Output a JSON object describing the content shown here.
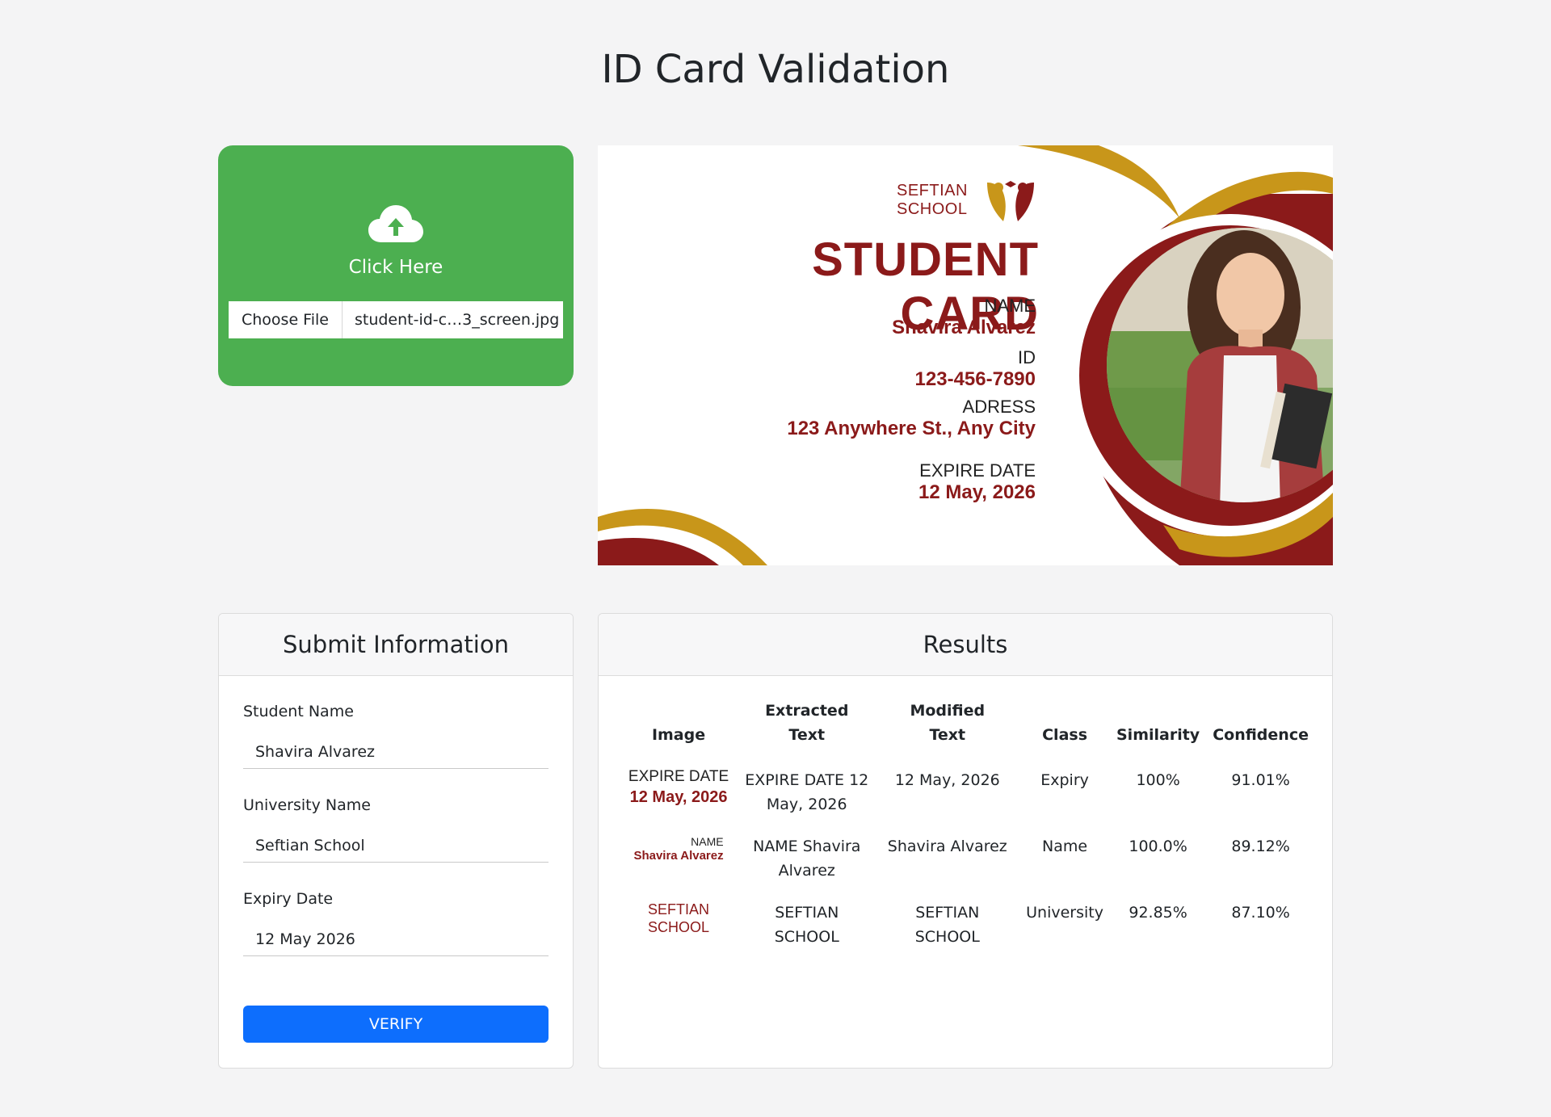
{
  "page": {
    "title": "ID Card Validation"
  },
  "upload": {
    "label": "Click Here",
    "choose_file": "Choose File",
    "file_name": "student-id-c…3_screen.jpg",
    "icon": "cloud-upload-icon"
  },
  "card": {
    "school_line1": "SEFTIAN",
    "school_line2": "SCHOOL",
    "title": "STUDENT CARD",
    "name_label": "NAME",
    "name_value": "Shavira Alvarez",
    "id_label": "ID",
    "id_value": "123-456-7890",
    "address_label": "ADRESS",
    "address_value": "123 Anywhere St., Any City",
    "expire_label": "EXPIRE DATE",
    "expire_value": "12 May, 2026",
    "colors": {
      "maroon": "#8b1a1a",
      "gold": "#c8961a"
    }
  },
  "submit": {
    "header": "Submit Information",
    "student_name_label": "Student Name",
    "student_name_value": "Shavira Alvarez",
    "university_label": "University Name",
    "university_value": "Seftian School",
    "expiry_label": "Expiry Date",
    "expiry_value": "12 May 2026",
    "verify_label": "VERIFY",
    "button_color": "#0d6efd"
  },
  "results": {
    "header": "Results",
    "columns": {
      "image": "Image",
      "extracted": "Extracted Text",
      "modified": "Modified Text",
      "class": "Class",
      "similarity": "Similarity",
      "confidence": "Confidence"
    },
    "rows": [
      {
        "image_label": "EXPIRE DATE",
        "image_value": "12 May, 2026",
        "extracted": "EXPIRE DATE 12 May, 2026",
        "modified": "12 May, 2026",
        "class": "Expiry",
        "similarity": "100%",
        "confidence": "91.01%"
      },
      {
        "image_label": "NAME",
        "image_value": "Shavira Alvarez",
        "extracted": "NAME Shavira Alvarez",
        "modified": "Shavira Alvarez",
        "class": "Name",
        "similarity": "100.0%",
        "confidence": "89.12%"
      },
      {
        "image_label": "SEFTIAN",
        "image_value": "SCHOOL",
        "extracted": "SEFTIAN SCHOOL",
        "modified": "SEFTIAN SCHOOL",
        "class": "University",
        "similarity": "92.85%",
        "confidence": "87.10%"
      }
    ]
  }
}
